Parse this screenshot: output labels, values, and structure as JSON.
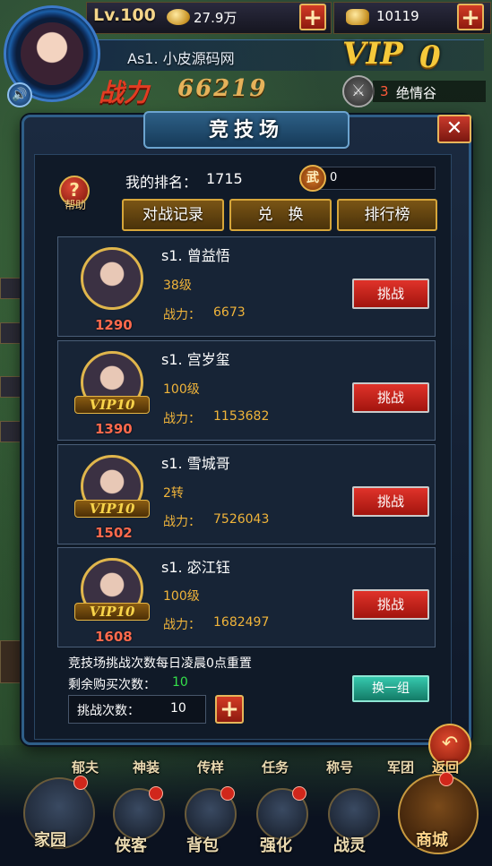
{
  "hud": {
    "level": "Lv.100",
    "gold": "27.9万",
    "ingot": "10119",
    "server_name": "As1. 小皮源码网",
    "vip_label": "VIP",
    "vip_level": "0",
    "power_label": "战力",
    "power_value": "66219",
    "location_index": "3",
    "location_name": "绝情谷",
    "plus_symbol": "+"
  },
  "arena": {
    "title": "竞技场",
    "help_label": "帮助",
    "help_icon": "?",
    "my_rank_label": "我的排名：",
    "my_rank_value": "1715",
    "token_icon_label": "武",
    "token_count": "0",
    "buttons": {
      "battle_record": "对战记录",
      "exchange": "兑　换",
      "leaderboard": "排行榜"
    },
    "opponents": [
      {
        "name": "s1. 曾益悟",
        "level": "38级",
        "power_label": "战力：",
        "power": "6673",
        "rank": "1290",
        "vip": "",
        "challenge": "挑战"
      },
      {
        "name": "s1. 宫岁玺",
        "level": "100级",
        "power_label": "战力：",
        "power": "1153682",
        "rank": "1390",
        "vip": "VIP10",
        "challenge": "挑战"
      },
      {
        "name": "s1. 雪城哥",
        "level": "2转",
        "power_label": "战力：",
        "power": "7526043",
        "rank": "1502",
        "vip": "VIP10",
        "challenge": "挑战"
      },
      {
        "name": "s1. 宓江钰",
        "level": "100级",
        "power_label": "战力：",
        "power": "1682497",
        "rank": "1608",
        "vip": "VIP10",
        "challenge": "挑战"
      }
    ],
    "reset_note": "竞技场挑战次数每日凌晨0点重置",
    "remaining_label": "剩余购买次数：",
    "remaining_value": "10",
    "refresh_button": "换一组",
    "challenge_count_label": "挑战次数：",
    "challenge_count_value": "10",
    "plus_symbol": "+",
    "close_symbol": "✕"
  },
  "side_menu_top": [
    "郁夫",
    "神装",
    "传样",
    "任务",
    "称号",
    "军团"
  ],
  "return_label": "返回",
  "bottom_nav": [
    "家园",
    "侠客",
    "背包",
    "强化",
    "战灵",
    "商城"
  ],
  "colors": {
    "accent_gold": "#f0b43a",
    "challenge_red": "#d8271f",
    "rank_red": "#ff6a4d",
    "remaining_green": "#34e04a",
    "refresh_teal": "#27b39a"
  }
}
